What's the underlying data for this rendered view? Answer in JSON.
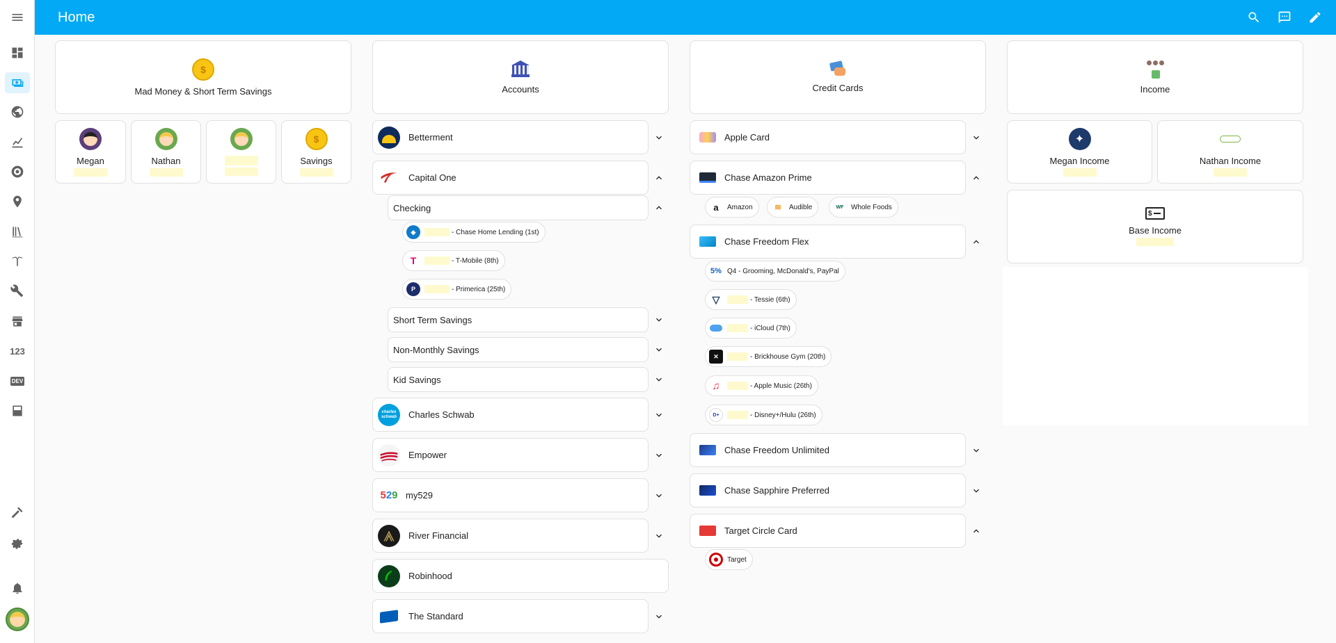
{
  "header": {
    "title": "Home"
  },
  "sidebar": {
    "items": [
      "overview-icon",
      "budget-icon",
      "map-globe-icon",
      "chart-icon",
      "target-icon",
      "location-icon",
      "library-icon",
      "tesla-icon",
      "wrench-icon",
      "store-icon",
      "numbers-icon",
      "dev-icon",
      "media-icon"
    ],
    "numbers_label": "123",
    "dev_label": "DEV"
  },
  "columns": {
    "mad_money": {
      "header": "Mad Money & Short Term Savings",
      "people": [
        {
          "name": "Megan"
        },
        {
          "name": "Nathan"
        },
        {
          "name": ""
        },
        {
          "name": "Savings"
        }
      ]
    },
    "accounts": {
      "header": "Accounts",
      "banks": [
        {
          "name": "Betterment",
          "logo_color": "#0f2a5c"
        },
        {
          "name": "Capital One",
          "logo_color": "#d03027"
        },
        {
          "name": "Charles Schwab",
          "logo_color": "#00a0df"
        },
        {
          "name": "Empower",
          "logo_color": "#c8102e"
        },
        {
          "name": "my529",
          "logo_color": "#ffffff"
        },
        {
          "name": "River Financial",
          "logo_color": "#1a1a1a"
        },
        {
          "name": "Robinhood",
          "logo_color": "#0b3d1a"
        },
        {
          "name": "The Standard",
          "logo_color": "#005eb8"
        }
      ],
      "capital_one_sub": {
        "checking": "Checking",
        "bills": [
          {
            "label": "- Chase Home Lending (1st)"
          },
          {
            "label": "- T-Mobile (8th)"
          },
          {
            "label": "- Primerica (25th)"
          }
        ],
        "others": [
          "Short Term Savings",
          "Non-Monthly Savings",
          "Kid Savings"
        ]
      },
      "my529_logo": "529",
      "schwab_logo": "charles schwab"
    },
    "credit_cards": {
      "header": "Credit Cards",
      "cards": [
        {
          "name": "Apple Card"
        },
        {
          "name": "Chase Amazon Prime"
        },
        {
          "name": "Chase Freedom Flex"
        },
        {
          "name": "Chase Freedom Unlimited"
        },
        {
          "name": "Chase Sapphire Preferred"
        },
        {
          "name": "Target Circle Card"
        }
      ],
      "amazon_chips": [
        "Amazon",
        "Audible",
        "Whole Foods"
      ],
      "flex_chips": [
        {
          "label": "Q4 - Grooming, McDonald's, PayPal",
          "icon": "5%"
        },
        {
          "label": "- Tessie (6th)"
        },
        {
          "label": "- iCloud (7th)"
        },
        {
          "label": "- Brickhouse Gym (20th)"
        },
        {
          "label": "- Apple Music (26th)"
        },
        {
          "label": "- Disney+/Hulu (26th)"
        }
      ],
      "target_chips": [
        "Target"
      ]
    },
    "income": {
      "header": "Income",
      "tiles": [
        {
          "name": "Megan Income"
        },
        {
          "name": "Nathan Income"
        },
        {
          "name": "Base Income"
        }
      ]
    }
  },
  "colors": {
    "header": "#03a9f4",
    "redacted": "#fffacd",
    "accent": "#03a9f4"
  }
}
